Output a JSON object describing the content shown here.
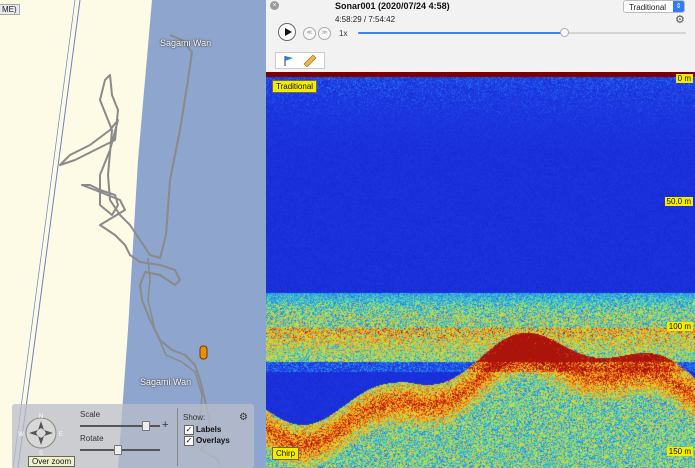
{
  "map": {
    "me_tab": "ME)",
    "place_labels": [
      "Sagami Wan",
      "Sagami Wan"
    ],
    "controls": {
      "compass_letters": {
        "n": "N",
        "w": "W",
        "e": "E",
        "s": "S"
      },
      "slider1_label": "Scale",
      "slider2_label": "Rotate",
      "show_label": "Show:",
      "labels_label": "Labels",
      "overlays_label": "Overlays",
      "labels_checked": true,
      "overlays_checked": true,
      "zoom_button": "Over zoom",
      "plus_symbol": "+"
    },
    "colors": {
      "land": "#fdfbe6",
      "water": "#8ea5cd",
      "track": "#8a8a8a",
      "marker": "#f08c00"
    }
  },
  "player": {
    "title": "Sonar001 (2020/07/24 4:58)",
    "timecode": "4:58:29 / 7:54:42",
    "mode": "Traditional",
    "speed": "1x",
    "progress": 0.628,
    "close_symbol": "×",
    "skip_back": "≪",
    "skip_forward": "≫",
    "gear_symbol": "⚙",
    "arrow_symbol": "⇕"
  },
  "sonar": {
    "top_tag": "Traditional",
    "bottom_tag": "Chirp",
    "depth_labels": [
      "0 m",
      "50.0 m",
      "100 m",
      "150 m"
    ]
  }
}
